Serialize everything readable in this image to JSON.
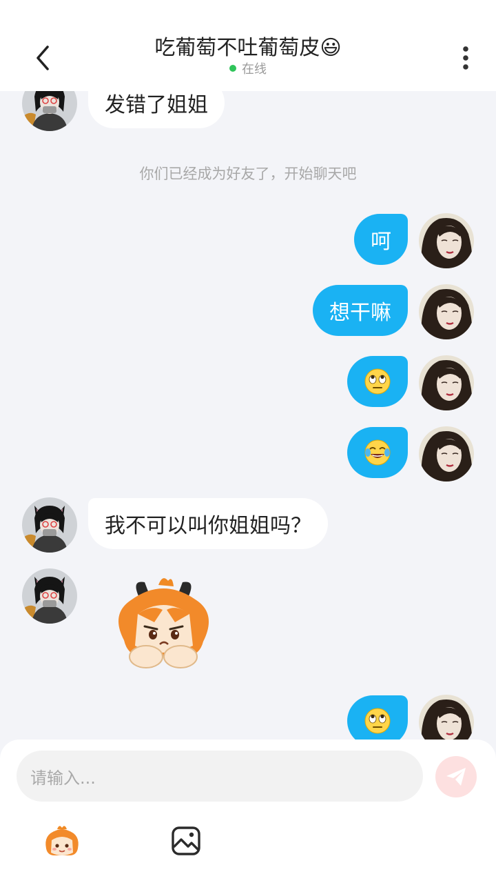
{
  "header": {
    "title": "吃葡萄不吐葡萄皮😃",
    "status": "在线"
  },
  "messages": {
    "m1": "发错了姐姐",
    "system": "你们已经成为好友了，开始聊天吧",
    "m2": "呵",
    "m3": "想干嘛",
    "m4_emoji": "eye-roll-emoji",
    "m5_emoji": "tears-of-joy-emoji",
    "m6": "我不可以叫你姐姐吗？",
    "m7_sticker": "pouting-cat-girl-sticker",
    "m8_emoji": "eye-roll-emoji"
  },
  "input": {
    "placeholder": "请输入..."
  },
  "toolbar": {
    "sticker_icon": "sticker-icon",
    "image_icon": "image-icon"
  },
  "colors": {
    "my_bubble": "#1ab2f3",
    "friend_bubble": "#ffffff",
    "background": "#f3f4f8",
    "online_dot": "#2fc45a",
    "send_button": "#fde0e0"
  }
}
